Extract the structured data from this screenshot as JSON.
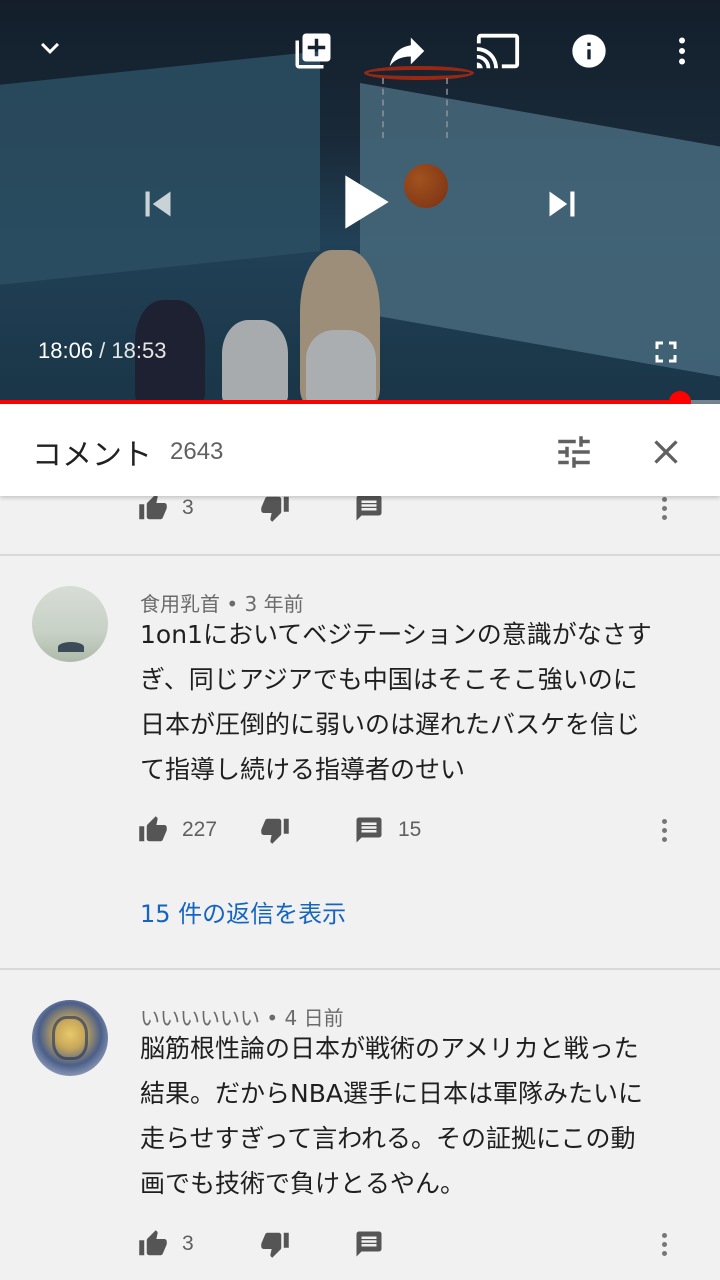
{
  "player": {
    "current_time": "18:06",
    "separator": " / ",
    "duration": "18:53",
    "progress": 0.944
  },
  "comments_header": {
    "title": "コメント",
    "count": "2643"
  },
  "partial_comment": {
    "likes": "3"
  },
  "comments": [
    {
      "author": "食用乳首",
      "age": "3 年前",
      "text_lines": [
        "1on1においてベジテーションの意識がなさす",
        "ぎ、同じアジアでも中国はそこそこ強いのに",
        "日本が圧倒的に弱いのは遅れたバスケを信じ",
        "て指導し続ける指導者のせい"
      ],
      "likes": "227",
      "reply_count": "15",
      "view_replies": "15 件の返信を表示"
    },
    {
      "author": "いいいいいい",
      "age": "4 日前",
      "text_lines": [
        "脳筋根性論の日本が戦術のアメリカと戦った",
        "結果。だからNBA選手に日本は軍隊みたいに",
        "走らせすぎって言われる。その証拠にこの動",
        "画でも技術で負けとるやん。"
      ],
      "likes": "3"
    }
  ],
  "meta_separator": " • ",
  "colors": {
    "accent_red": "#ff0000",
    "link_blue": "#1565c0",
    "background": "#f1f1f1"
  },
  "icons": [
    "chevron-down-icon",
    "add-to-playlist-icon",
    "share-icon",
    "cast-icon",
    "info-icon",
    "more-vert-icon",
    "previous-icon",
    "play-icon",
    "next-icon",
    "fullscreen-icon",
    "filter-icon",
    "close-icon",
    "thumb-up-icon",
    "thumb-down-icon",
    "reply-icon"
  ]
}
